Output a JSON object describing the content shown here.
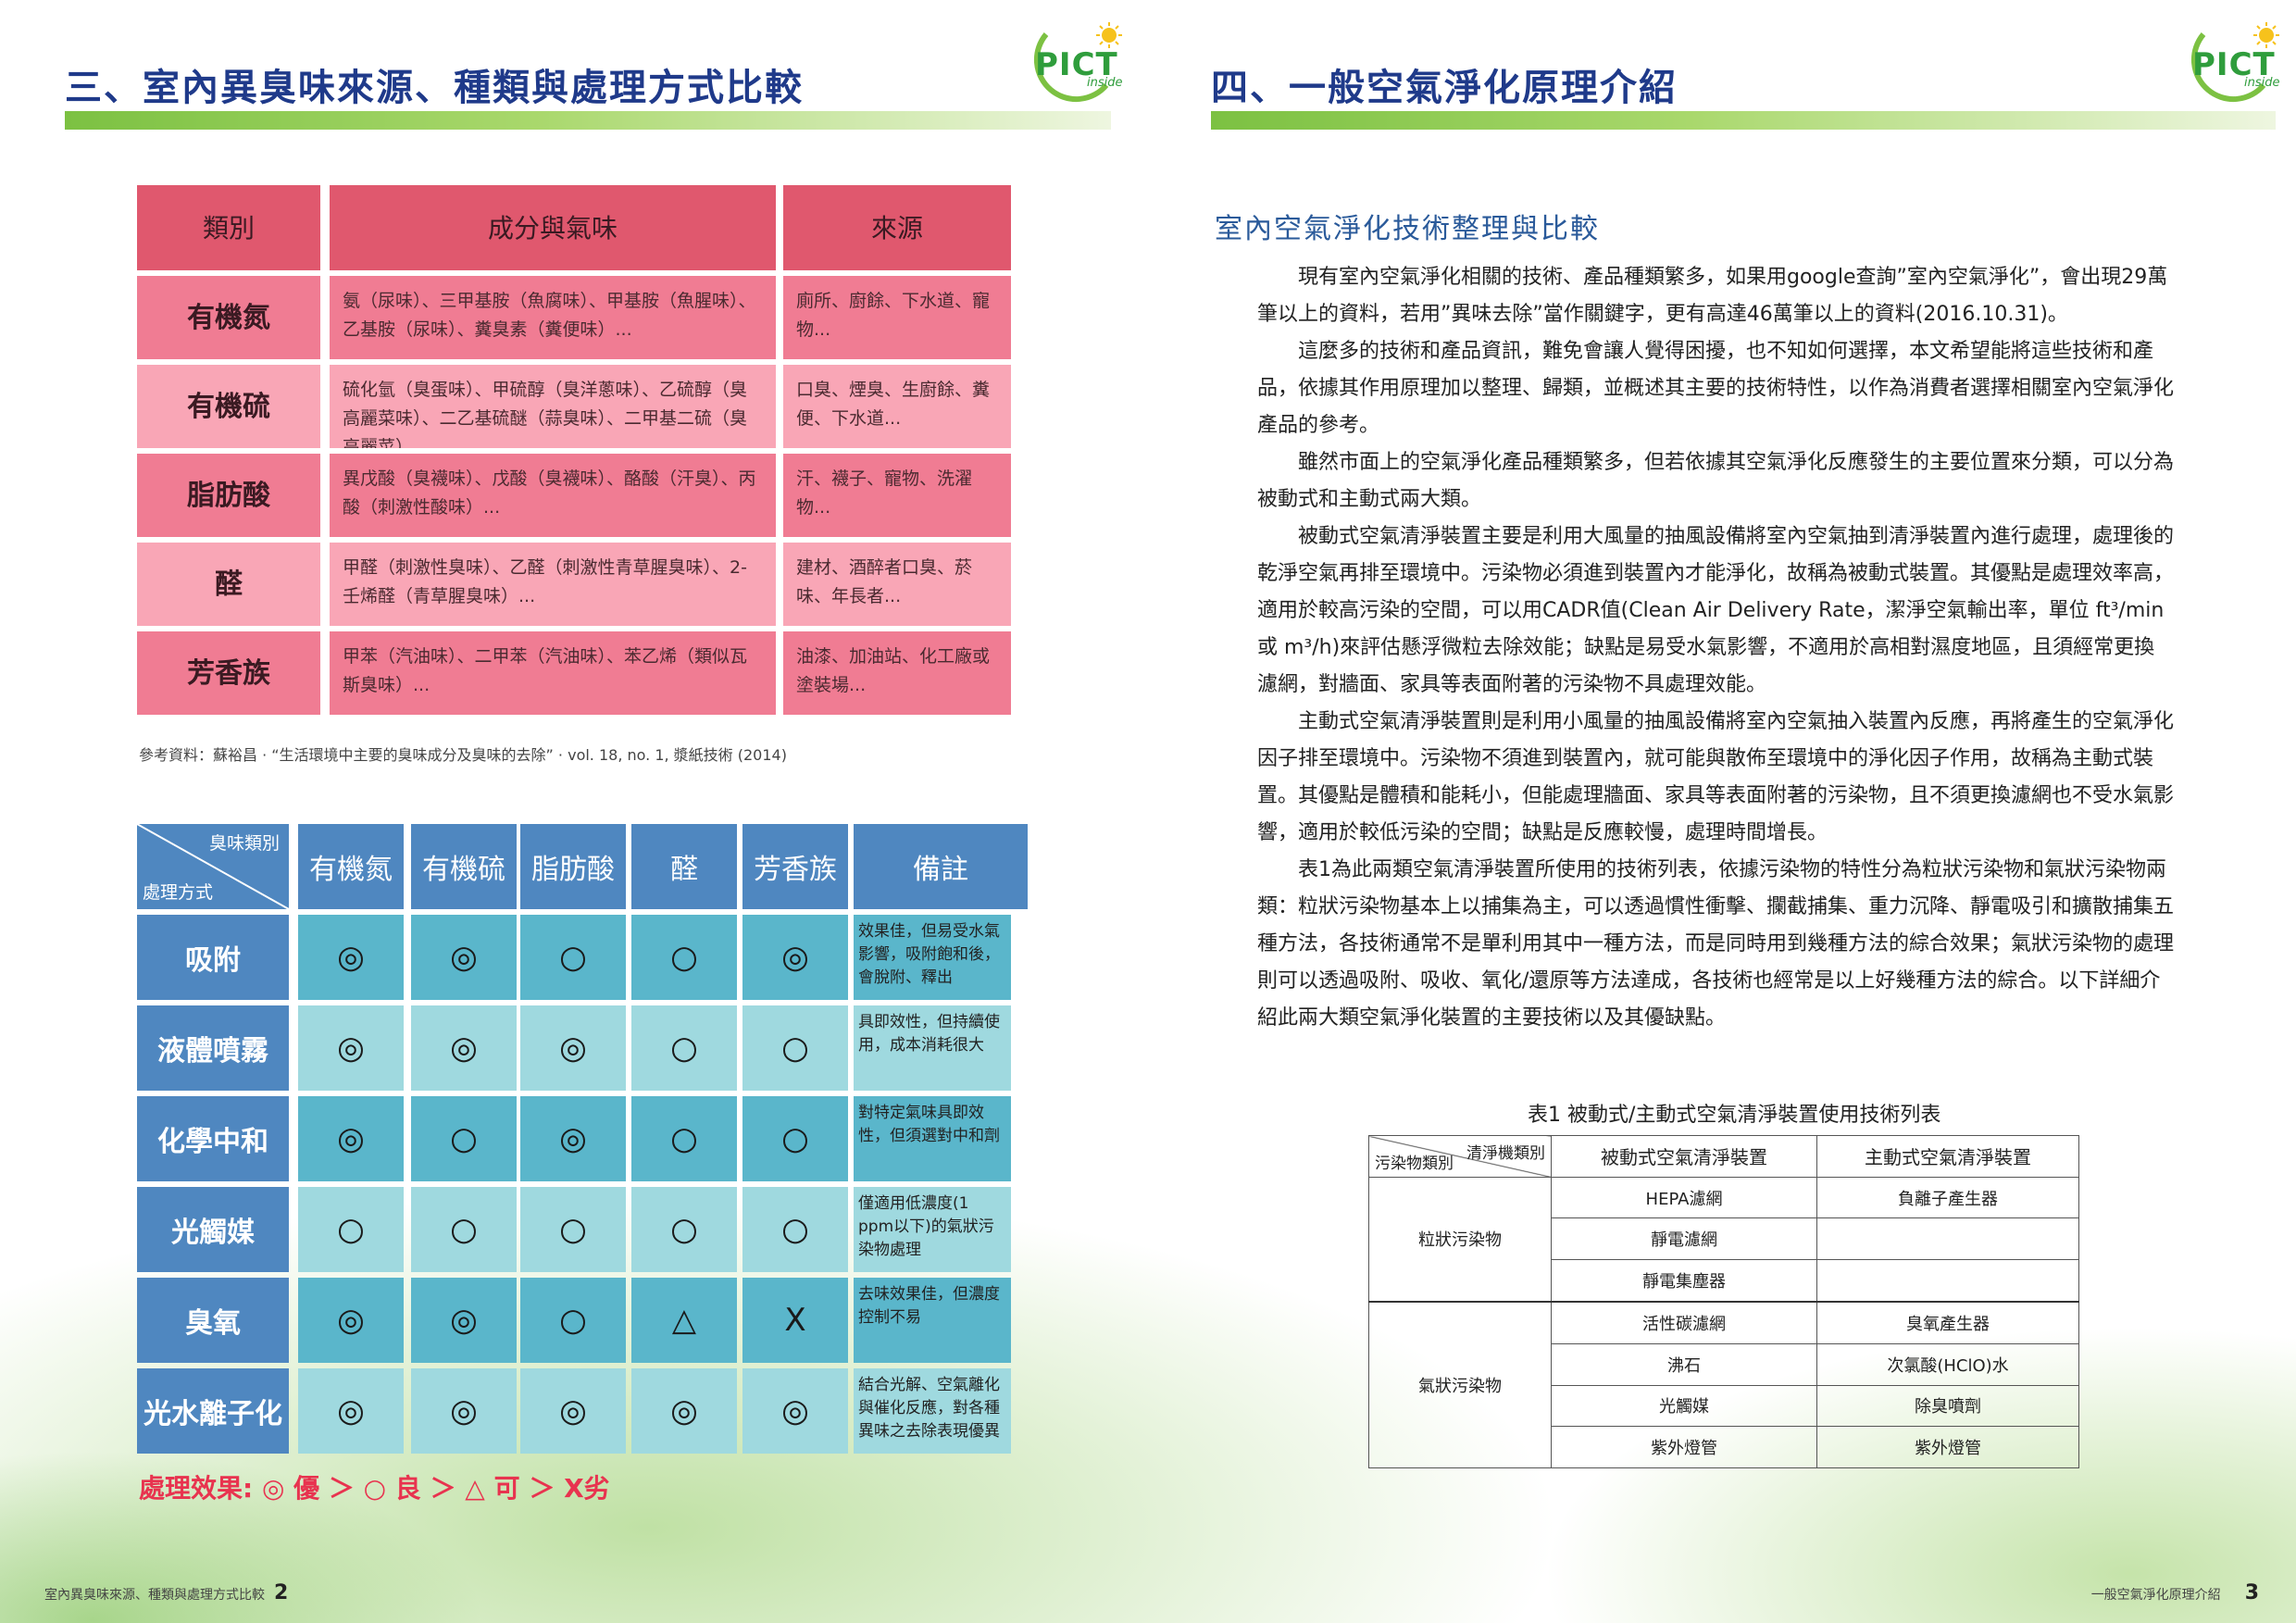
{
  "brand": {
    "logo_text": "PICT",
    "logo_sub": "inside",
    "accent": "#7cc142",
    "title_color": "#1f3a8a"
  },
  "left": {
    "heading": "三、室內異臭味來源、種類與處理方式比較",
    "odor_table": {
      "headers": [
        "類別",
        "成分與氣味",
        "來源"
      ],
      "rows": [
        {
          "category": "有機氮",
          "components": "氨（尿味）、三甲基胺（魚腐味）、甲基胺（魚腥味）、乙基胺（尿味）、糞臭素（糞便味）...",
          "source": "廁所、廚餘、下水道、寵物..."
        },
        {
          "category": "有機硫",
          "components": "硫化氫（臭蛋味）、甲硫醇（臭洋蔥味）、乙硫醇（臭高麗菜味）、二乙基硫醚（蒜臭味）、二甲基二硫（臭高麗菜）...",
          "source": "口臭、煙臭、生廚餘、糞便、下水道..."
        },
        {
          "category": "脂肪酸",
          "components": "異戊酸（臭襪味）、戊酸（臭襪味）、酪酸（汗臭）、丙酸（刺激性酸味）...",
          "source": "汗、襪子、寵物、洗濯物..."
        },
        {
          "category": "醛",
          "components": "甲醛（刺激性臭味）、乙醛（刺激性青草腥臭味）、2-壬烯醛（青草腥臭味）...",
          "source": "建材、酒醉者口臭、菸味、年長者..."
        },
        {
          "category": "芳香族",
          "components": "甲苯（汽油味）、二甲苯（汽油味）、苯乙烯（類似瓦斯臭味）...",
          "source": "油漆、加油站、化工廠或塗裝場..."
        }
      ]
    },
    "reference": "參考資料：蘇裕昌 · “生活環境中主要的臭味成分及臭味的去除” · vol. 18, no. 1, 漿紙技術 (2014)",
    "treat_table": {
      "corner_top": "臭味類別",
      "corner_bottom": "處理方式",
      "headers": [
        "有機氮",
        "有機硫",
        "脂肪酸",
        "醛",
        "芳香族",
        "備註"
      ],
      "rows": [
        {
          "method": "吸附",
          "marks": [
            "◎",
            "◎",
            "○",
            "○",
            "◎"
          ],
          "note": "效果佳，但易受水氣影響，吸附飽和後，會脫附、釋出"
        },
        {
          "method": "液體噴霧",
          "marks": [
            "◎",
            "◎",
            "◎",
            "○",
            "○"
          ],
          "note": "具即效性，但持續使用，成本消耗很大"
        },
        {
          "method": "化學中和",
          "marks": [
            "◎",
            "○",
            "◎",
            "○",
            "○"
          ],
          "note": "對特定氣味具即效性，但須選對中和劑"
        },
        {
          "method": "光觸媒",
          "marks": [
            "○",
            "○",
            "○",
            "○",
            "○"
          ],
          "note": "僅適用低濃度(1 ppm以下)的氣狀污染物處理"
        },
        {
          "method": "臭氧",
          "marks": [
            "◎",
            "◎",
            "○",
            "△",
            "X"
          ],
          "note": "去味效果佳，但濃度控制不易"
        },
        {
          "method": "光水離子化",
          "marks": [
            "◎",
            "◎",
            "◎",
            "◎",
            "◎"
          ],
          "note": "結合光解、空氣離化與催化反應，對各種異味之去除表現優異"
        }
      ]
    },
    "legend": "處理效果: ◎ 優 ＞ ○ 良 ＞ △ 可 ＞ X劣",
    "footer_text": "室內異臭味來源、種類與處理方式比較",
    "footer_page": "2"
  },
  "right": {
    "heading": "四、一般空氣淨化原理介紹",
    "subtitle": "室內空氣淨化技術整理與比較",
    "paragraphs": [
      "現有室內空氣淨化相關的技術、產品種類繁多，如果用google查詢”室內空氣淨化”，會出現29萬筆以上的資料，若用”異味去除”當作關鍵字，更有高達46萬筆以上的資料(2016.10.31)。",
      "這麼多的技術和產品資訊，難免會讓人覺得困擾，也不知如何選擇，本文希望能將這些技術和產品，依據其作用原理加以整理、歸類，並概述其主要的技術特性，以作為消費者選擇相關室內空氣淨化產品的參考。",
      "雖然市面上的空氣淨化產品種類繁多，但若依據其空氣淨化反應發生的主要位置來分類，可以分為被動式和主動式兩大類。",
      "被動式空氣清淨裝置主要是利用大風量的抽風設備將室內空氣抽到清淨裝置內進行處理，處理後的乾淨空氣再排至環境中。污染物必須進到裝置內才能淨化，故稱為被動式裝置。其優點是處理效率高，適用於較高污染的空間，可以用CADR值(Clean Air Delivery Rate，潔淨空氣輸出率，單位 ft³/min 或 m³/h)來評估懸浮微粒去除效能；缺點是易受水氣影響，不適用於高相對濕度地區，且須經常更換濾網，對牆面、家具等表面附著的污染物不具處理效能。",
      "主動式空氣清淨裝置則是利用小風量的抽風設備將室內空氣抽入裝置內反應，再將產生的空氣淨化因子排至環境中。污染物不須進到裝置內，就可能與散佈至環境中的淨化因子作用，故稱為主動式裝置。其優點是體積和能耗小，但能處理牆面、家具等表面附著的污染物，且不須更換濾網也不受水氣影響，適用於較低污染的空間；缺點是反應較慢，處理時間增長。",
      "表1為此兩類空氣清淨裝置所使用的技術列表，依據污染物的特性分為粒狀污染物和氣狀污染物兩類：粒狀污染物基本上以捕集為主，可以透過慣性衝擊、攔截捕集、重力沉降、靜電吸引和擴散捕集五種方法，各技術通常不是單利用其中一種方法，而是同時用到幾種方法的綜合效果；氣狀污染物的處理則可以透過吸附、吸收、氧化/還原等方法達成，各技術也經常是以上好幾種方法的綜合。以下詳細介紹此兩大類空氣淨化裝置的主要技術以及其優缺點。"
    ],
    "table_caption": "表1 被動式/主動式空氣清淨裝置使用技術列表",
    "tech_table": {
      "corner_top": "清淨機類別",
      "corner_bottom": "污染物類別",
      "col1": "被動式空氣清淨裝置",
      "col2": "主動式空氣清淨裝置",
      "group1": "粒狀污染物",
      "group1_rows": [
        [
          "HEPA濾網",
          "負離子產生器"
        ],
        [
          "靜電濾網",
          ""
        ],
        [
          "靜電集塵器",
          ""
        ]
      ],
      "group2": "氣狀污染物",
      "group2_rows": [
        [
          "活性碳濾網",
          "臭氧產生器"
        ],
        [
          "沸石",
          "次氯酸(HClO)水"
        ],
        [
          "光觸媒",
          "除臭噴劑"
        ],
        [
          "紫外燈管",
          "紫外燈管"
        ]
      ]
    },
    "footer_text": "一般空氣淨化原理介紹",
    "footer_page": "3"
  }
}
